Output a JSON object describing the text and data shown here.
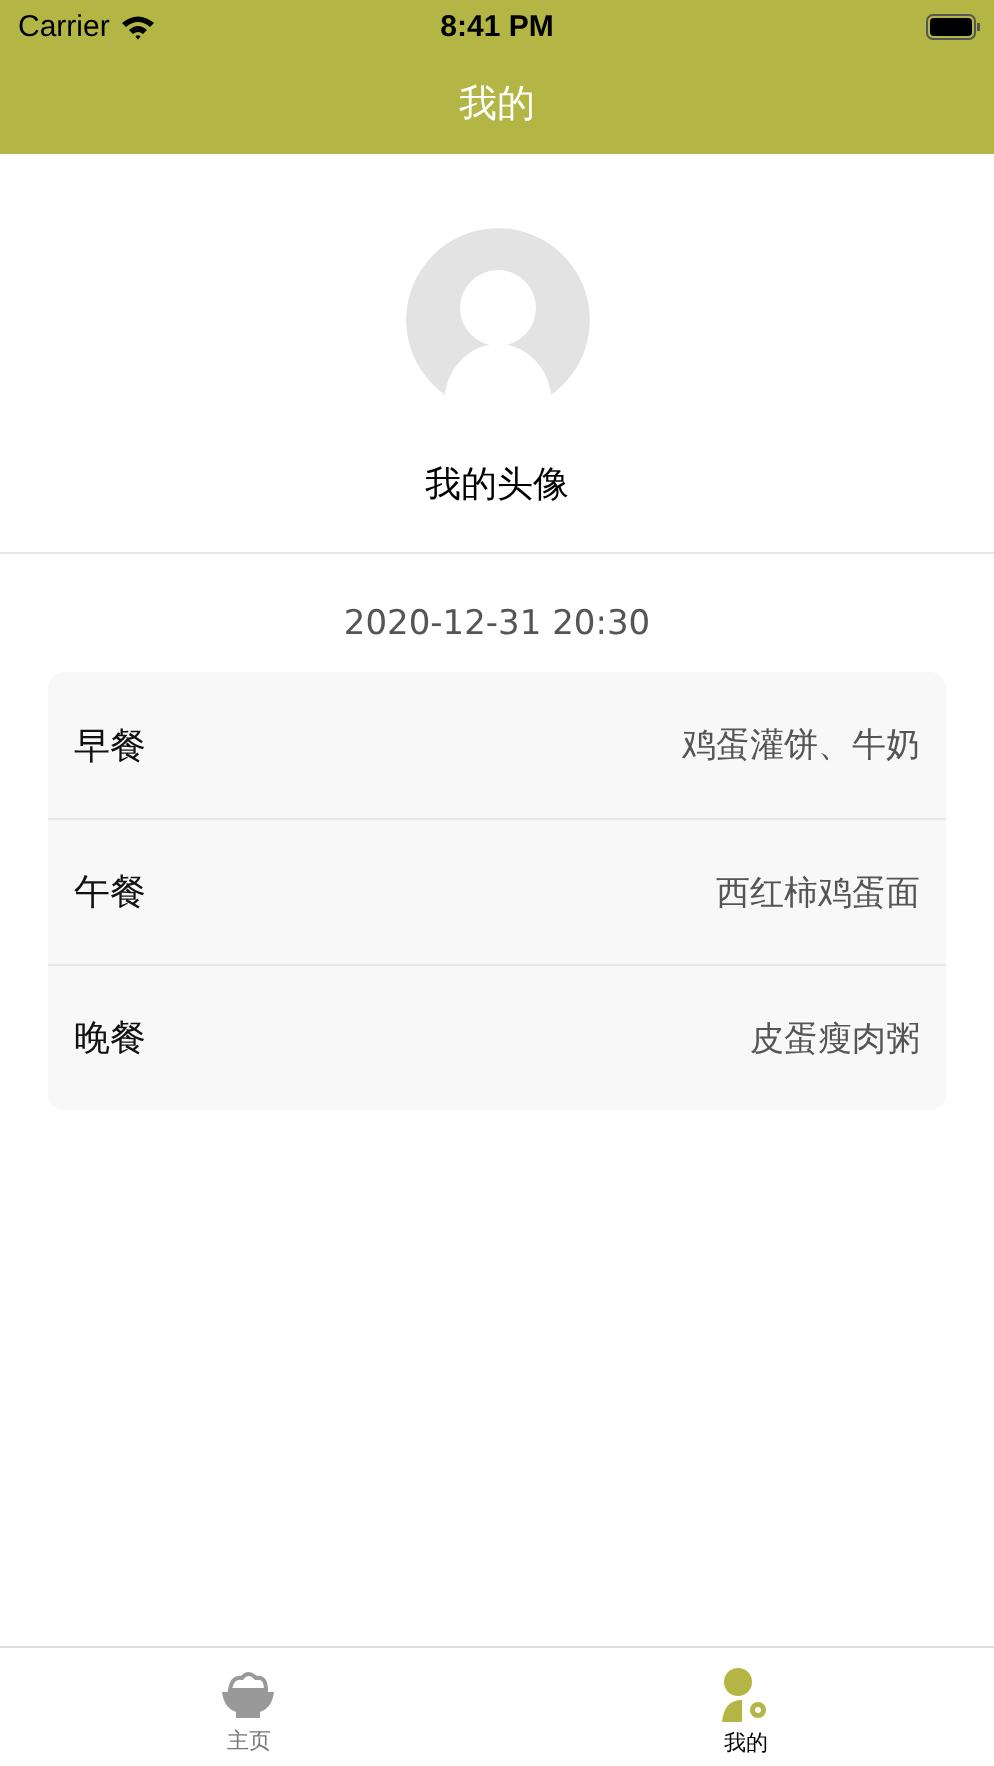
{
  "status_bar": {
    "carrier": "Carrier",
    "time": "8:41 PM"
  },
  "nav_bar": {
    "title": "我的"
  },
  "profile": {
    "avatar_label": "我的头像"
  },
  "date": "2020-12-31  20:30",
  "meals": [
    {
      "label": "早餐",
      "value": "鸡蛋灌饼、牛奶"
    },
    {
      "label": "午餐",
      "value": "西红柿鸡蛋面"
    },
    {
      "label": "晚餐",
      "value": "皮蛋瘦肉粥"
    }
  ],
  "tab_bar": [
    {
      "kind": "home",
      "label": "主页",
      "selected": false
    },
    {
      "kind": "profile",
      "label": "我的",
      "selected": true
    }
  ]
}
